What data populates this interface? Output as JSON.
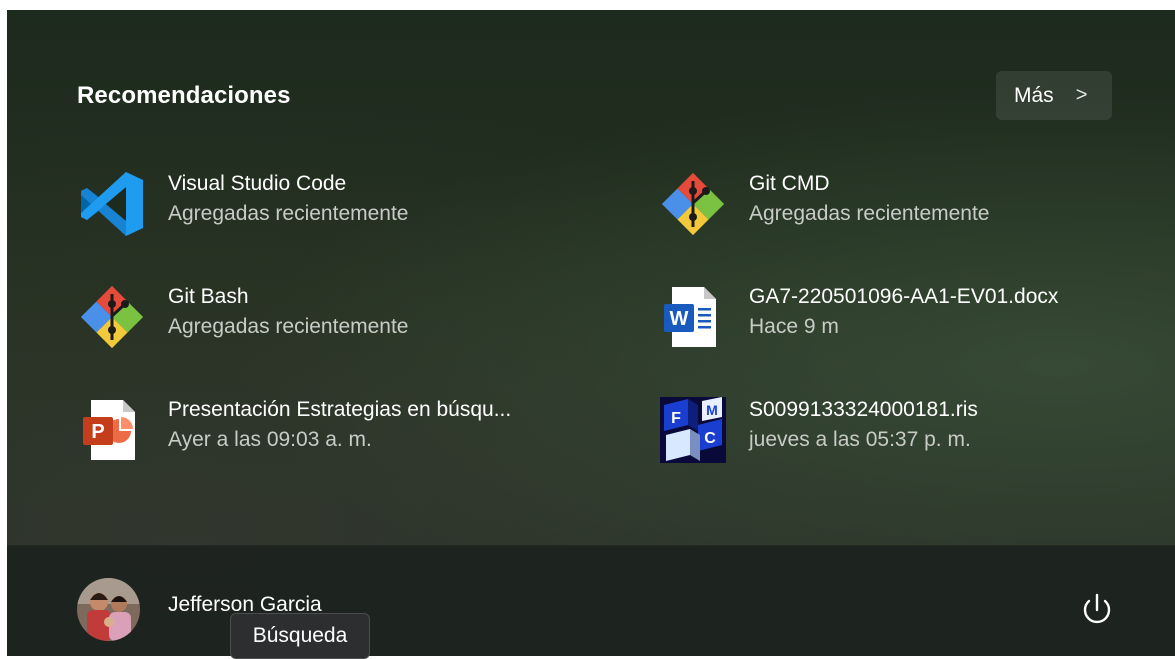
{
  "recommendations": {
    "title": "Recomendaciones",
    "more_label": "Más",
    "more_chevron": ">",
    "items": [
      {
        "name": "Visual Studio Code",
        "subtitle": "Agregadas recientemente",
        "icon": "vscode-icon"
      },
      {
        "name": "Git CMD",
        "subtitle": "Agregadas recientemente",
        "icon": "git-icon"
      },
      {
        "name": "Git Bash",
        "subtitle": "Agregadas recientemente",
        "icon": "git-icon"
      },
      {
        "name": "GA7-220501096-AA1-EV01.docx",
        "subtitle": "Hace 9 m",
        "icon": "word-document-icon",
        "icon_letter": "W"
      },
      {
        "name": "Presentación Estrategias en búsqu...",
        "subtitle": "Ayer a las 09:03 a. m.",
        "icon": "powerpoint-document-icon",
        "icon_letter": "P"
      },
      {
        "name": "S0099133324000181.ris",
        "subtitle": "jueves a las 05:37 p. m.",
        "icon": "ris-file-icon",
        "icon_letters": [
          "M",
          "F",
          "C"
        ]
      }
    ]
  },
  "footer": {
    "user_name": "Jefferson Garcia",
    "power_icon": "power-icon"
  },
  "tooltip": {
    "text": "Búsqueda"
  },
  "colors": {
    "vscode_blue": "#1f9cf0",
    "git_red": "#e64a3b",
    "git_green": "#7cc242",
    "git_blue": "#4a8fe8",
    "git_yellow": "#f3c93c",
    "word_blue": "#185abd",
    "powerpoint_orange": "#c43e1c"
  }
}
